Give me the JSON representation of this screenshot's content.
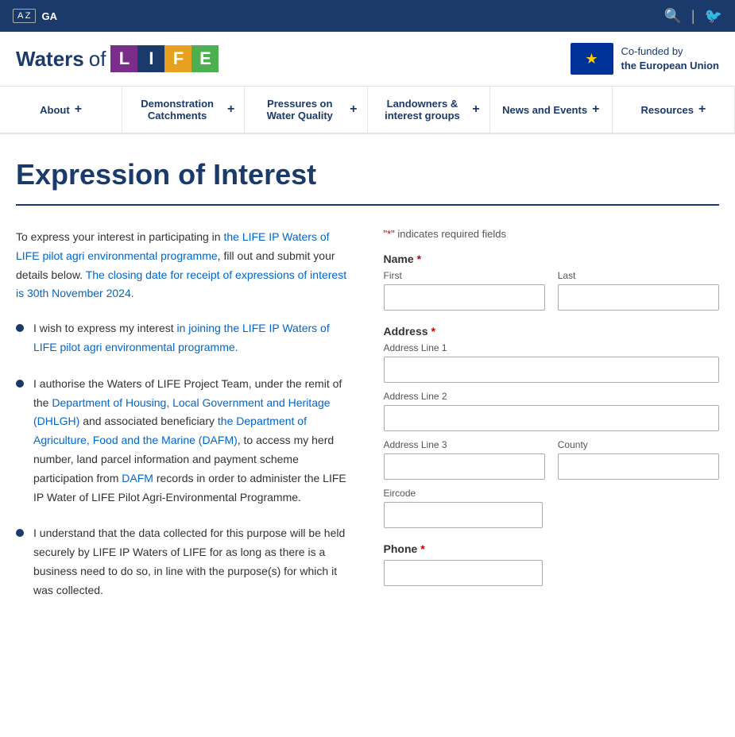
{
  "topBar": {
    "badge": "A Z",
    "lang": "GA",
    "searchIcon": "🔍",
    "twitterIcon": "🐦"
  },
  "header": {
    "logoWaters": "Waters",
    "logoOf": "of",
    "logoLetters": [
      {
        "letter": "L",
        "class": "L"
      },
      {
        "letter": "I",
        "class": "I"
      },
      {
        "letter": "F",
        "class": "F"
      },
      {
        "letter": "E",
        "class": "E"
      }
    ],
    "euText1": "Co-funded by",
    "euText2": "the European Union"
  },
  "nav": {
    "items": [
      {
        "label": "About",
        "plus": "+"
      },
      {
        "label": "Demonstration Catchments",
        "plus": "+"
      },
      {
        "label": "Pressures on Water Quality",
        "plus": "+"
      },
      {
        "label": "Landowners & interest groups",
        "plus": "+"
      },
      {
        "label": "News and Events",
        "plus": "+"
      },
      {
        "label": "Resources",
        "plus": "+"
      }
    ]
  },
  "page": {
    "title": "Expression of Interest",
    "introParagraph": "To express your interest in participating in the LIFE IP Waters of LIFE pilot agri environmental programme, fill out and submit your details below. The closing date  for receipt of expressions of interest is 30th November 2024.",
    "bullets": [
      "I wish to express my interest in joining the LIFE IP Waters of LIFE pilot agri environmental programme.",
      "I authorise the Waters of LIFE Project Team, under the remit of the Department of Housing, Local Government and Heritage (DHLGH) and associated beneficiary the Department of Agriculture, Food and the Marine (DAFM), to access my herd number, land parcel information and payment scheme participation from DAFM records in order to administer the LIFE IP Water of LIFE Pilot Agri-Environmental Programme.",
      "I understand that the data collected for this purpose will be held securely by LIFE IP Waters of LIFE for as long as there is a business need to do so, in line with the purpose(s) for which it was collected."
    ]
  },
  "form": {
    "requiredNote": "\"*\" indicates required fields",
    "requiredStar": "*",
    "nameLabel": "Name",
    "firstLabel": "First",
    "lastLabel": "Last",
    "addressLabel": "Address",
    "addressLine1Label": "Address Line 1",
    "addressLine2Label": "Address Line 2",
    "addressLine3Label": "Address Line 3",
    "countyLabel": "County",
    "eircodeLabel": "Eircode",
    "phoneLabel": "Phone"
  }
}
